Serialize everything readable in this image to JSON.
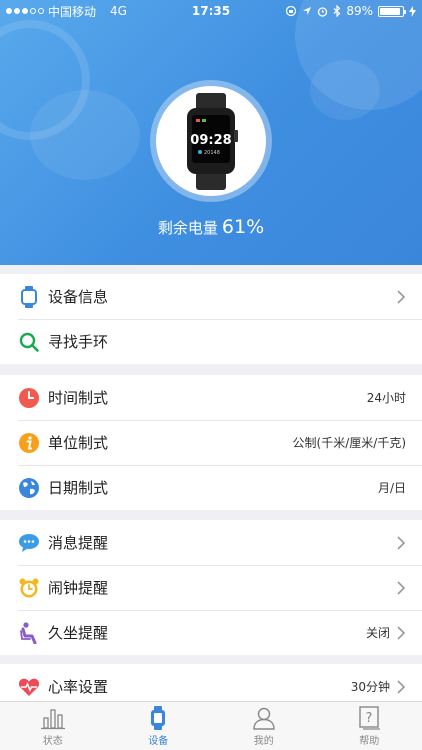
{
  "status_bar": {
    "carrier": "中国移动",
    "network": "4G",
    "time": "17:35",
    "battery_percent_text": "89%",
    "battery_level": 0.89
  },
  "device": {
    "watch_time": "09:28",
    "watch_label": "20148",
    "battery_label": "剩余电量",
    "battery_value": "61%"
  },
  "groups": [
    {
      "items": [
        {
          "key": "device-info",
          "label": "设备信息",
          "icon": "watch-icon",
          "value": "",
          "chevron": true
        },
        {
          "key": "find-band",
          "label": "寻找手环",
          "icon": "search-icon",
          "value": "",
          "chevron": false
        }
      ]
    },
    {
      "items": [
        {
          "key": "time-format",
          "label": "时间制式",
          "icon": "clock-icon",
          "value": "24小时",
          "chevron": false
        },
        {
          "key": "unit-format",
          "label": "单位制式",
          "icon": "info-icon",
          "value": "公制(千米/厘米/千克)",
          "chevron": false
        },
        {
          "key": "date-format",
          "label": "日期制式",
          "icon": "globe-icon",
          "value": "月/日",
          "chevron": false
        }
      ]
    },
    {
      "items": [
        {
          "key": "message-reminder",
          "label": "消息提醒",
          "icon": "chat-icon",
          "value": "",
          "chevron": true
        },
        {
          "key": "alarm-reminder",
          "label": "闹钟提醒",
          "icon": "alarm-icon",
          "value": "",
          "chevron": true
        },
        {
          "key": "sedentary-reminder",
          "label": "久坐提醒",
          "icon": "sitting-icon",
          "value": "关闭",
          "chevron": true
        }
      ]
    },
    {
      "items": [
        {
          "key": "heart-rate",
          "label": "心率设置",
          "icon": "heart-icon",
          "value": "30分钟",
          "chevron": true
        }
      ]
    }
  ],
  "tabs": [
    {
      "label": "状态",
      "icon": "bar-chart-icon",
      "active": false
    },
    {
      "label": "设备",
      "icon": "watch-icon",
      "active": true
    },
    {
      "label": "我的",
      "icon": "user-icon",
      "active": false
    },
    {
      "label": "帮助",
      "icon": "help-icon",
      "active": false
    }
  ],
  "colors": {
    "accent": "#3a86db",
    "header_start": "#58a9ec",
    "header_end": "#3a86db"
  }
}
